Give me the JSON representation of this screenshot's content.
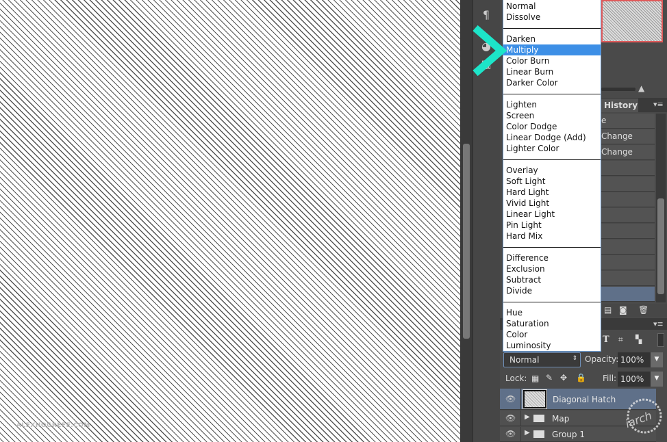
{
  "watermark": "ALEXHOGREFE.COM",
  "blend_menu": {
    "groups": [
      [
        "Normal",
        "Dissolve"
      ],
      [
        "Darken",
        "Multiply",
        "Color Burn",
        "Linear Burn",
        "Darker Color"
      ],
      [
        "Lighten",
        "Screen",
        "Color Dodge",
        "Linear Dodge (Add)",
        "Lighter Color"
      ],
      [
        "Overlay",
        "Soft Light",
        "Hard Light",
        "Vivid Light",
        "Linear Light",
        "Pin Light",
        "Hard Mix"
      ],
      [
        "Difference",
        "Exclusion",
        "Subtract",
        "Divide"
      ],
      [
        "Hue",
        "Saturation",
        "Color",
        "Luminosity"
      ]
    ],
    "highlighted": "Multiply"
  },
  "history": {
    "tab": "History",
    "rows": [
      "e",
      "Change",
      "Change",
      "",
      "",
      "",
      "",
      "",
      "",
      "",
      "",
      ""
    ]
  },
  "layers": {
    "blend_mode": "Normal",
    "opacity_label": "Opacity:",
    "opacity": "100%",
    "lock_label": "Lock:",
    "fill_label": "Fill:",
    "fill": "100%",
    "items": [
      {
        "name": "Diagonal Hatch",
        "type": "layer",
        "selected": true
      },
      {
        "name": "Map",
        "type": "group"
      },
      {
        "name": "Group 1",
        "type": "group"
      }
    ]
  },
  "stamp_text": "iarch",
  "colors": {
    "highlight": "#3d8fe6",
    "selected_layer": "#5f7089",
    "chevron": "#1de5c9"
  }
}
